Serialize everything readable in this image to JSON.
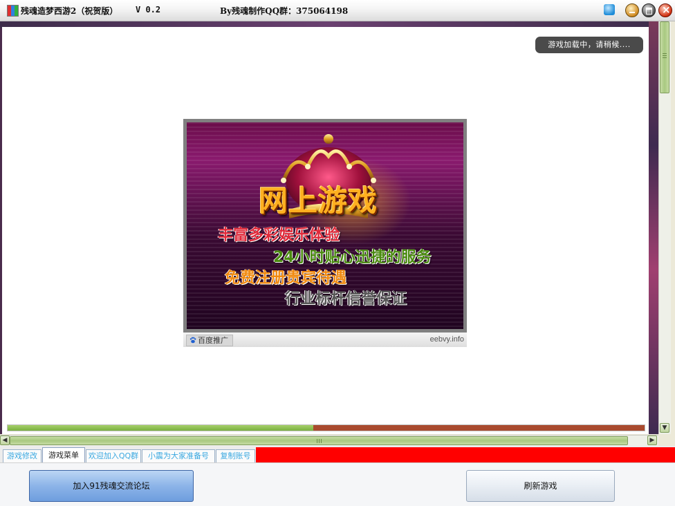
{
  "window": {
    "title": "残魂造梦西游2（祝贺版）",
    "version": "V 0.2",
    "credit": "By残魂制作QQ群：375064198"
  },
  "content": {
    "loading_tip": "游戏加载中，请稍候....",
    "loading_progress_percent": 48,
    "ad": {
      "headline": "网上游戏",
      "lines": [
        "丰富多彩娱乐体验",
        "24小时贴心迅捷的服务",
        "免费注册贵宾待遇",
        "行业标杆信誉保证"
      ],
      "source_label": "百度推广",
      "site": "eebvy.info"
    }
  },
  "tabs": [
    {
      "label": "游戏修改",
      "active": false
    },
    {
      "label": "游戏菜单",
      "active": true
    },
    {
      "label": "欢迎加入QQ群",
      "active": false
    },
    {
      "label": "小震为大家准备号",
      "active": false
    },
    {
      "label": "复制账号",
      "active": false
    }
  ],
  "buttons": {
    "forum": "加入91残魂交流论坛",
    "refresh": "刷新游戏"
  },
  "colors": {
    "progress_done": "#8dc050",
    "progress_remaining": "#a94a2e",
    "tab_strip_accent": "#ff0000",
    "forum_button": "#8cb4e8"
  },
  "icons": [
    "app-icon",
    "skin-icon",
    "minimize-icon",
    "maximize-icon",
    "close-icon",
    "paw-icon"
  ]
}
